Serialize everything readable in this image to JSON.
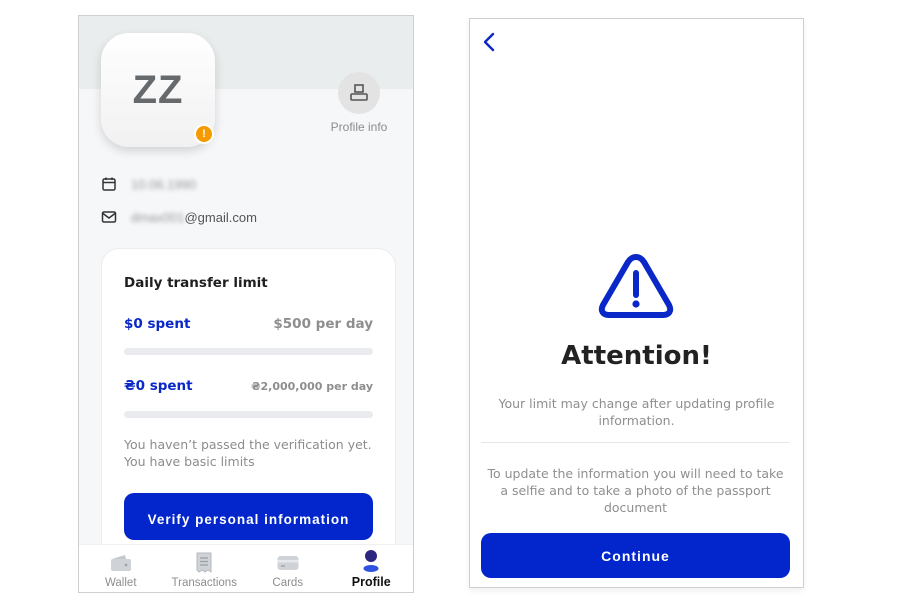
{
  "profile_screen": {
    "avatar_initials": "ZZ",
    "warning_badge": "!",
    "profile_info_label": "Profile info",
    "birthdate_blurred": "10.06.1990",
    "email_blurred_prefix": "dmax001",
    "email_domain": "@gmail.com",
    "limit_card": {
      "title": "Daily transfer limit",
      "rows": [
        {
          "spent": "$0 spent",
          "limit": "$500 per day",
          "progress": 0
        },
        {
          "spent": "₴0 spent",
          "limit": "₴2,000,000 per day",
          "progress": 0
        }
      ],
      "note": "You haven’t passed the verification yet. You have basic limits",
      "verify_button": "Verify personal information"
    },
    "bottom_nav": [
      {
        "label": "Wallet",
        "icon": "wallet-icon",
        "active": false
      },
      {
        "label": "Transactions",
        "icon": "receipt-icon",
        "active": false
      },
      {
        "label": "Cards",
        "icon": "card-icon",
        "active": false
      },
      {
        "label": "Profile",
        "icon": "profile-icon",
        "active": true
      }
    ]
  },
  "attention_screen": {
    "back_icon": "chevron-left-icon",
    "title": "Attention!",
    "text1": "Your limit may change after updating profile information.",
    "text2": "To update the information you will need to take a selfie and to take a photo of the passport document",
    "continue_button": "Continue"
  },
  "colors": {
    "accent": "#0226cc",
    "warning": "#f59b00"
  }
}
